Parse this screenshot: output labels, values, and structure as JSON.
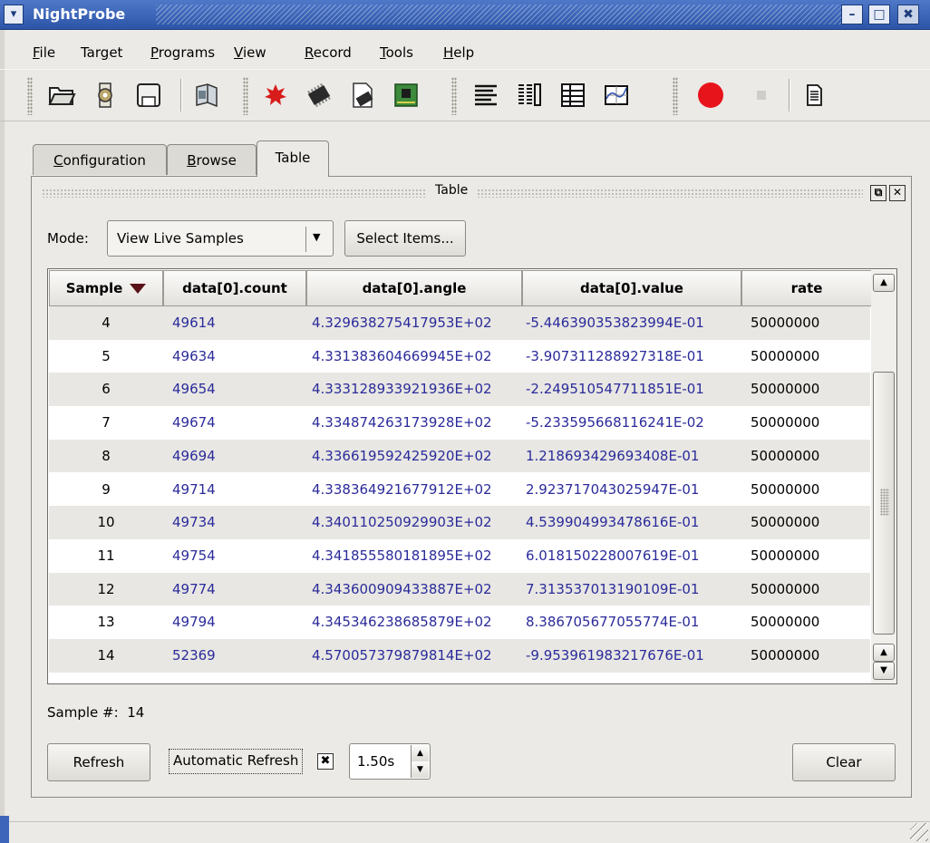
{
  "window": {
    "title": "NightProbe",
    "min": "–",
    "max": "□",
    "close": "✖",
    "menu": "▾"
  },
  "menubar": [
    {
      "pre": "",
      "u": "F",
      "post": "ile"
    },
    {
      "pre": "Tar",
      "u": "g",
      "post": "et"
    },
    {
      "pre": "",
      "u": "P",
      "post": "rograms"
    },
    {
      "pre": "",
      "u": "V",
      "post": "iew"
    },
    {
      "pre": "",
      "u": "R",
      "post": "ecord"
    },
    {
      "pre": "",
      "u": "T",
      "post": "ools"
    },
    {
      "pre": "",
      "u": "H",
      "post": "elp"
    }
  ],
  "toolbar_icons": [
    "open-folder-icon",
    "gear-puzzle-icon",
    "save-floppy-icon",
    "book-icon",
    "burst-icon",
    "chip-icon",
    "chip-page-icon",
    "board-icon",
    "align-left-icon",
    "columns-icon",
    "table-icon",
    "graph-icon",
    "record-icon",
    "stop-icon",
    "page-icon"
  ],
  "tabs": {
    "configuration": {
      "u": "C",
      "post": "onfiguration"
    },
    "browse": {
      "u": "B",
      "post": "rowse"
    },
    "table": "Table"
  },
  "dock": {
    "title": "Table",
    "float": "⧉",
    "close": "✕"
  },
  "mode": {
    "label": "Mode:",
    "value": "View Live Samples",
    "arrow": "▼",
    "select_button": "Select Items..."
  },
  "table": {
    "columns": [
      "Sample",
      "data[0].count",
      "data[0].angle",
      "data[0].value",
      "rate"
    ],
    "rows": [
      [
        "4",
        "49614",
        "4.329638275417953E+02",
        "-5.446390353823994E-01",
        "50000000"
      ],
      [
        "5",
        "49634",
        "4.331383604669945E+02",
        "-3.907311288927318E-01",
        "50000000"
      ],
      [
        "6",
        "49654",
        "4.333128933921936E+02",
        "-2.249510547711851E-01",
        "50000000"
      ],
      [
        "7",
        "49674",
        "4.334874263173928E+02",
        "-5.233595668116241E-02",
        "50000000"
      ],
      [
        "8",
        "49694",
        "4.336619592425920E+02",
        "1.218693429693408E-01",
        "50000000"
      ],
      [
        "9",
        "49714",
        "4.338364921677912E+02",
        "2.923717043025947E-01",
        "50000000"
      ],
      [
        "10",
        "49734",
        "4.340110250929903E+02",
        "4.539904993478616E-01",
        "50000000"
      ],
      [
        "11",
        "49754",
        "4.341855580181895E+02",
        "6.018150228007619E-01",
        "50000000"
      ],
      [
        "12",
        "49774",
        "4.343600909433887E+02",
        "7.313537013190109E-01",
        "50000000"
      ],
      [
        "13",
        "49794",
        "4.345346238685879E+02",
        "8.386705677055774E-01",
        "50000000"
      ],
      [
        "14",
        "52369",
        "4.570057379879814E+02",
        "-9.953961983217676E-01",
        "50000000"
      ]
    ]
  },
  "sample_number": {
    "label": "Sample #:",
    "value": "14"
  },
  "controls": {
    "refresh": "Refresh",
    "auto_refresh_label": "Automatic Refresh",
    "auto_refresh_checked": "✖",
    "interval": "1.50s",
    "clear": "Clear"
  }
}
